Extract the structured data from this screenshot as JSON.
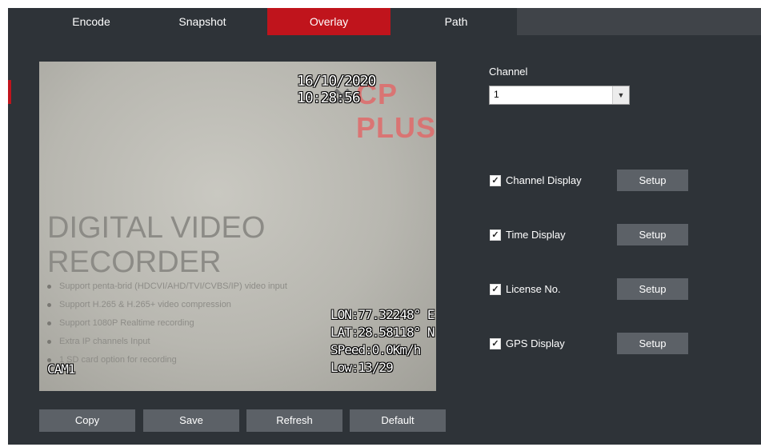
{
  "tabs": [
    {
      "label": "Encode",
      "active": false
    },
    {
      "label": "Snapshot",
      "active": false
    },
    {
      "label": "Overlay",
      "active": true
    },
    {
      "label": "Path",
      "active": false
    }
  ],
  "preview": {
    "watermark_brand": "CP PLUS",
    "osd_time": "16/10/2020 10:28:56",
    "osd_gps": [
      "LON:77.32248° E",
      "LAT:28.58118° N",
      "SPeed:0.0Km/h",
      "Low:13/29"
    ],
    "osd_cam": "CAM1",
    "paper_title": "DIGITAL VIDEO RECORDER",
    "paper_list": [
      "Support penta-brid (HDCVI/AHD/TVI/CVBS/IP) video input",
      "Support H.265 & H.265+ video compression",
      "Support 1080P Realtime recording",
      "Extra IP channels Input",
      "1 SD card option for recording"
    ]
  },
  "buttons": {
    "copy": "Copy",
    "save": "Save",
    "refresh": "Refresh",
    "default": "Default"
  },
  "channel": {
    "label": "Channel",
    "value": "1"
  },
  "options": [
    {
      "label": "Channel Display",
      "checked": true,
      "setup": "Setup"
    },
    {
      "label": "Time Display",
      "checked": true,
      "setup": "Setup"
    },
    {
      "label": "License No.",
      "checked": true,
      "setup": "Setup"
    },
    {
      "label": "GPS Display",
      "checked": true,
      "setup": "Setup"
    }
  ],
  "colors": {
    "accent": "#c0141c",
    "panel": "#2e3338",
    "button": "#5c6167"
  },
  "icons": {
    "checkbox": "checkmark-icon",
    "dropdown": "chevron-down-icon"
  }
}
